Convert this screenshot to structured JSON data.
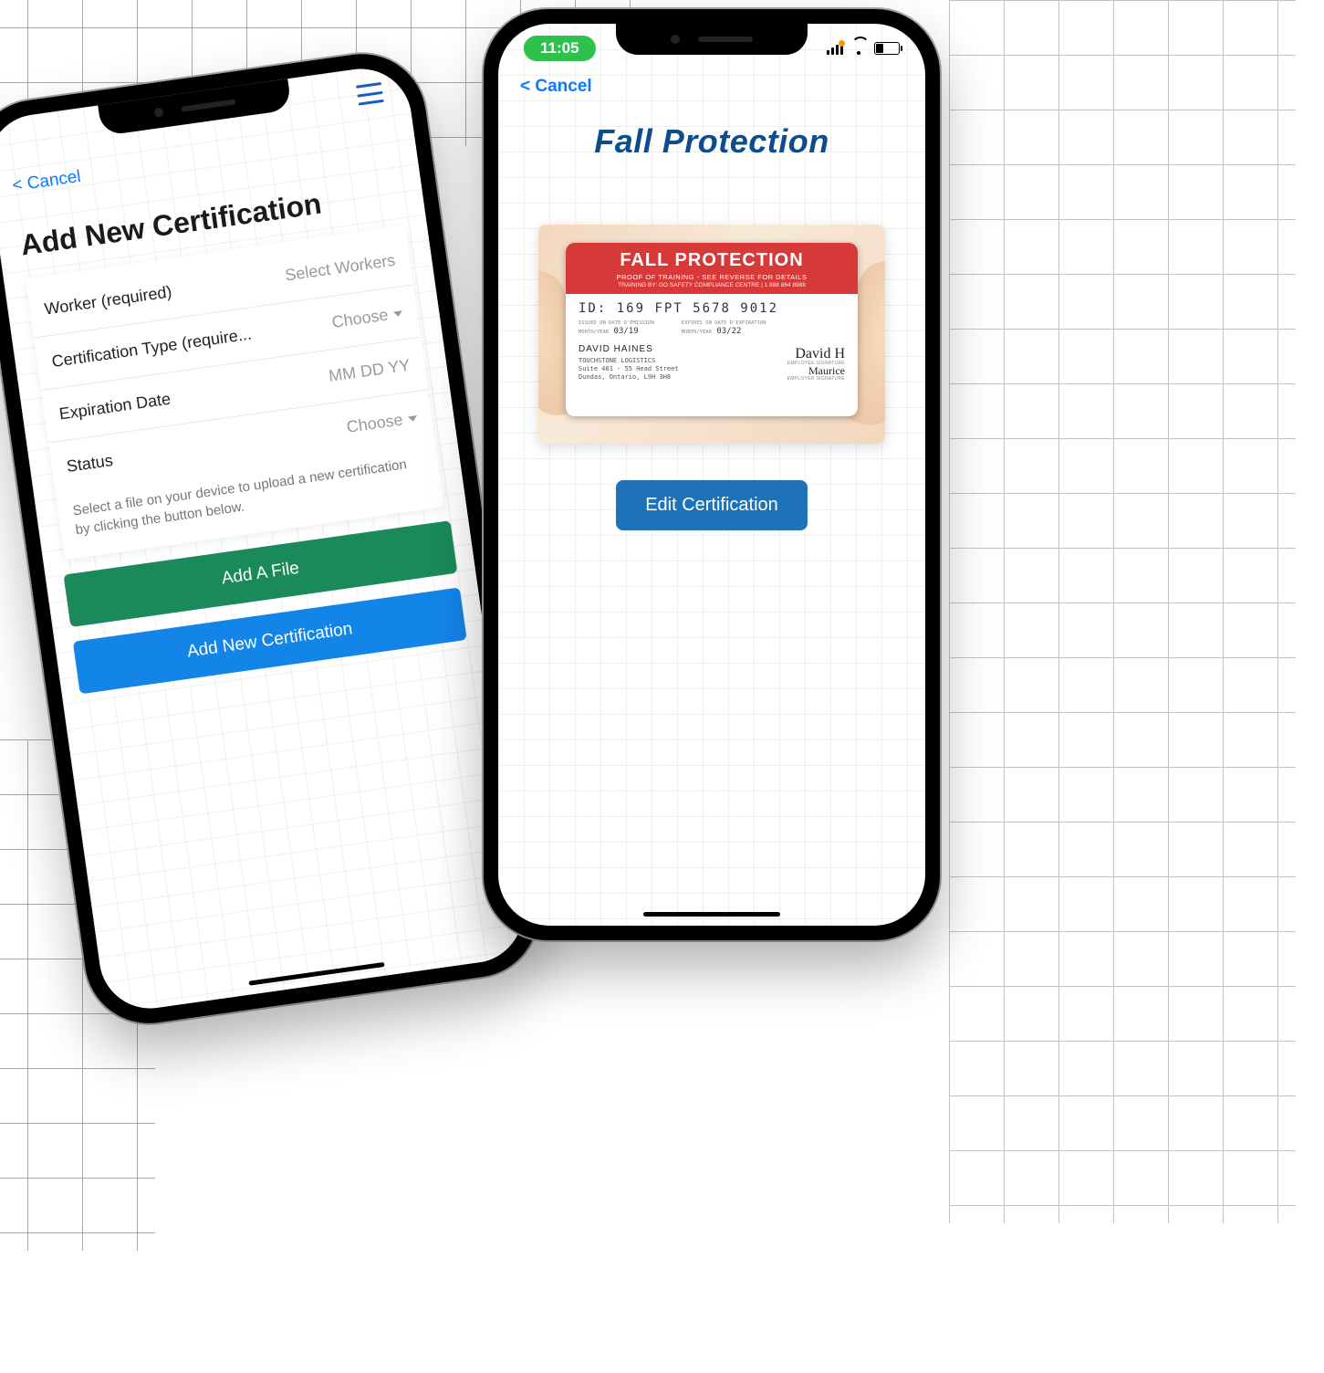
{
  "phone1": {
    "cancel": "< Cancel",
    "title": "Add New Certification",
    "rows": {
      "worker_label": "Worker (required)",
      "worker_value": "Select Workers",
      "cert_label": "Certification Type (require...",
      "cert_value": "Choose",
      "exp_label": "Expiration Date",
      "exp_value": "MM DD YY",
      "status_label": "Status",
      "status_value": "Choose"
    },
    "helper": "Select a file on your device to upload a new certification by clicking the button below.",
    "buttons": {
      "add_file": "Add A File",
      "submit": "Add New Certification"
    }
  },
  "phone2": {
    "status_time": "11:05",
    "cancel": "< Cancel",
    "title": "Fall Protection",
    "card": {
      "heading": "FALL PROTECTION",
      "sub1": "PROOF OF TRAINING - SEE REVERSE FOR DETAILS",
      "sub2": "TRAINING BY: GO SAFETY COMPLIANCE CENTRE | 1 888 864 8988",
      "id_label": "ID:",
      "id_value": "169 FPT 5678 9012",
      "issued_lbl": "ISSUED ON\nDATE D'ÉMISSION",
      "issued_val": "03/19",
      "month_lbl": "MONTH/YEAR",
      "expires_lbl": "EXPIRES ON\nDATE D'EXPIRATION",
      "expires_val": "03/22",
      "name": "DAVID HAINES",
      "company": "TOUCHSTONE LOGISTICS",
      "addr1": "Suite 401 - 55 Head Street",
      "addr2": "Dundas, Ontario, L9H 3H8",
      "sig1": "David H",
      "sig1_lbl": "EMPLOYEE SIGNATURE",
      "sig2": "Maurice",
      "sig2_lbl": "EMPLOYER SIGNATURE"
    },
    "edit_button": "Edit Certification"
  }
}
